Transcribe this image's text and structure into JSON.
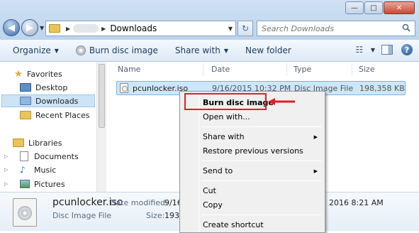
{
  "window": {
    "caption_buttons": {
      "minimize": "—",
      "maximize": "□",
      "close": "✕"
    }
  },
  "navigation": {
    "back_glyph": "◀",
    "forward_glyph": "▶",
    "history_glyph": "▼"
  },
  "address": {
    "arrow": "▶",
    "current": "Downloads",
    "dropdown_glyph": "▼"
  },
  "refresh_glyph": "↻",
  "search": {
    "placeholder": "Search Downloads"
  },
  "toolbar": {
    "organize": "Organize",
    "burn": "Burn disc image",
    "share": "Share with",
    "new_folder": "New folder",
    "dropdown_glyph": "▼",
    "views_glyph": "☷",
    "help_glyph": "?"
  },
  "sidebar": {
    "favorites": {
      "label": "Favorites",
      "items": [
        "Desktop",
        "Downloads",
        "Recent Places"
      ]
    },
    "libraries": {
      "label": "Libraries",
      "items": [
        "Documents",
        "Music",
        "Pictures"
      ]
    }
  },
  "columns": {
    "name": "Name",
    "date": "Date",
    "type": "Type",
    "size": "Size"
  },
  "file": {
    "name": "pcunlocker.iso",
    "date": "9/16/2015 10:32 PM",
    "type": "Disc Image File",
    "size": "198,358 KB"
  },
  "details": {
    "name": "pcunlocker.iso",
    "type": "Disc Image File",
    "date_modified_label": "Date modified:",
    "date_modified_partial": "9/16",
    "date_created_partial": "2016 8:21 AM",
    "size_label": "Size:",
    "size_partial": "193"
  },
  "context_menu": {
    "burn": "Burn disc image",
    "open_with": "Open with...",
    "share_with": "Share with",
    "restore": "Restore previous versions",
    "send_to": "Send to",
    "cut": "Cut",
    "copy": "Copy",
    "create_shortcut": "Create shortcut",
    "submenu_glyph": "▶"
  },
  "colors": {
    "highlight_border": "#e21e26",
    "selection": "#cde6fa"
  }
}
